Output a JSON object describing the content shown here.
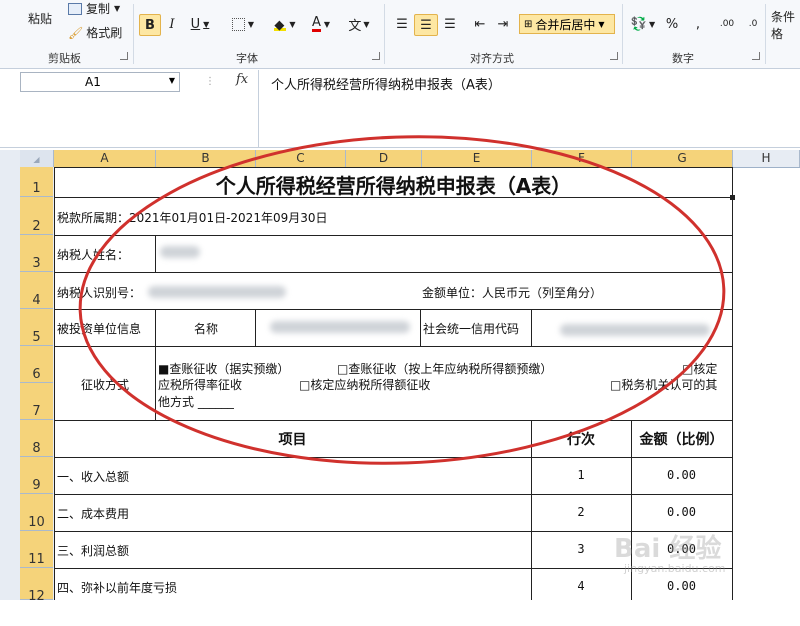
{
  "ribbon": {
    "clipboard": {
      "paste": "粘贴",
      "copy": "复制",
      "format_painter": "格式刷",
      "label": "剪贴板"
    },
    "font": {
      "bold": "B",
      "italic": "I",
      "underline": "U",
      "font_color_glyph": "A",
      "label": "字体"
    },
    "alignment": {
      "merge_center": "合并后居中",
      "label": "对齐方式"
    },
    "number": {
      "percent": "%",
      "comma": ",",
      "inc_decimal": ".00",
      "dec_decimal": ".0",
      "label": "数字"
    },
    "styles": {
      "conditional": "条件格"
    },
    "wen": "文"
  },
  "formula_bar": {
    "name_box": "A1",
    "fx": "fx",
    "formula": "个人所得税经营所得纳税申报表（A表）"
  },
  "columns": [
    "A",
    "B",
    "C",
    "D",
    "E",
    "F",
    "G",
    "H"
  ],
  "rows": [
    "1",
    "2",
    "3",
    "4",
    "5",
    "6",
    "7",
    "8",
    "9",
    "10",
    "11",
    "12"
  ],
  "sheet": {
    "title": "个人所得税经营所得纳税申报表（A表）",
    "period": "税款所属期：2021年01月01日-2021年09月30日",
    "taxpayer_name_label": "纳税人姓名：",
    "taxpayer_id_label": "纳税人识别号：",
    "amount_unit": "金额单位：人民币元（列至角分）",
    "investee_label": "被投资单位信息",
    "name_label": "名称",
    "credit_code_label": "社会统一信用代码",
    "collection_label": "征收方式",
    "collection_line1_a": "■查账征收（据实预缴）",
    "collection_line1_b": "□查账征收（按上年应纳税所得额预缴）",
    "collection_line1_c": "□核定",
    "collection_line2_a": "应税所得率征收",
    "collection_line2_b": "□核定应纳税所得额征收",
    "collection_line2_c": "□税务机关认可的其",
    "collection_line3": "他方式 ______",
    "hdr_item": "项目",
    "hdr_row": "行次",
    "hdr_amount": "金额（比例）",
    "items": [
      {
        "label": "一、收入总额",
        "row": "1",
        "amount": "0.00"
      },
      {
        "label": "二、成本费用",
        "row": "2",
        "amount": "0.00"
      },
      {
        "label": "三、利润总额",
        "row": "3",
        "amount": "0.00"
      },
      {
        "label": "四、弥补以前年度亏损",
        "row": "4",
        "amount": "0.00"
      }
    ]
  },
  "watermark": {
    "text": "Bai 经验",
    "sub": "jingyan.baidu.com"
  },
  "colors": {
    "annotation": "#d0312d",
    "selected_header": "#f5d37a",
    "merge_active": "#fde7a3"
  }
}
